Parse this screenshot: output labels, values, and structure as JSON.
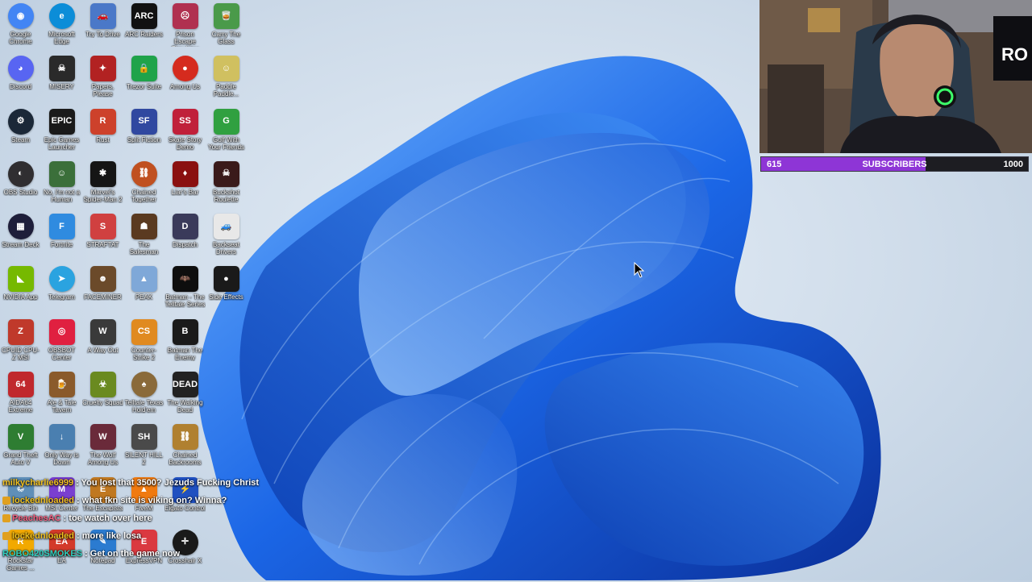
{
  "desktop_icons": [
    {
      "label": "Google Chrome",
      "icon": "chrome-icon",
      "color": "#4285f4",
      "glyph": "◉",
      "round": true
    },
    {
      "label": "Discord",
      "icon": "discord-icon",
      "color": "#5865f2",
      "glyph": "◕",
      "round": true
    },
    {
      "label": "Steam",
      "icon": "steam-icon",
      "color": "#1b2838",
      "glyph": "⚙",
      "round": true
    },
    {
      "label": "OBS Studio",
      "icon": "obs-icon",
      "color": "#302e31",
      "glyph": "◐",
      "round": true
    },
    {
      "label": "Stream Deck",
      "icon": "stream-deck-icon",
      "color": "#1e1e3a",
      "glyph": "▦",
      "round": true
    },
    {
      "label": "NVIDIA App",
      "icon": "nvidia-icon",
      "color": "#76b900",
      "glyph": "◣",
      "round": false
    },
    {
      "label": "CPUID CPU-Z MSI",
      "icon": "cpuz-icon",
      "color": "#c0392b",
      "glyph": "Z",
      "round": false
    },
    {
      "label": "AIDA64 Extreme",
      "icon": "aida64-icon",
      "color": "#c0282d",
      "glyph": "64",
      "round": false
    },
    {
      "label": "Grand Theft Auto V",
      "icon": "gta5-icon",
      "color": "#2e7d32",
      "glyph": "V",
      "round": false
    },
    {
      "label": "Recycle Bin",
      "icon": "recycle-bin-icon",
      "color": "#5f8fb8",
      "glyph": "♲",
      "round": false
    },
    {
      "label": "Rockstar Games ...",
      "icon": "rockstar-icon",
      "color": "#f2a900",
      "glyph": "R",
      "round": false
    },
    {
      "label": "Microsoft Edge",
      "icon": "edge-icon",
      "color": "#0c8dd8",
      "glyph": "e",
      "round": true
    },
    {
      "label": "MISERY",
      "icon": "misery-icon",
      "color": "#2a2a2a",
      "glyph": "☠",
      "round": false
    },
    {
      "label": "Epic Games Launcher",
      "icon": "epic-games-icon",
      "color": "#1a1a1a",
      "glyph": "EPIC",
      "round": false
    },
    {
      "label": "No, I'm not a Human",
      "icon": "no-im-not-human-icon",
      "color": "#3b6f3a",
      "glyph": "☺",
      "round": false
    },
    {
      "label": "Fortnite",
      "icon": "fortnite-icon",
      "color": "#2f8be0",
      "glyph": "F",
      "round": false
    },
    {
      "label": "Telegram",
      "icon": "telegram-icon",
      "color": "#2aa3e0",
      "glyph": "➤",
      "round": true
    },
    {
      "label": "OBSBOT Center",
      "icon": "obsbot-icon",
      "color": "#e02040",
      "glyph": "◎",
      "round": false
    },
    {
      "label": "Ale & Tale Tavern",
      "icon": "ale-tale-icon",
      "color": "#8a5a2b",
      "glyph": "🍺",
      "round": false
    },
    {
      "label": "Only Way is Down",
      "icon": "only-way-down-icon",
      "color": "#4a7fb0",
      "glyph": "↓",
      "round": false
    },
    {
      "label": "MSI Center",
      "icon": "msi-center-icon",
      "color": "#7a3fd0",
      "glyph": "M",
      "round": false
    },
    {
      "label": "EA",
      "icon": "ea-icon",
      "color": "#d33a2a",
      "glyph": "EA",
      "round": false
    },
    {
      "label": "Try To Drive",
      "icon": "try-to-drive-icon",
      "color": "#4a78c8",
      "glyph": "🚗",
      "round": false
    },
    {
      "label": "Papers, Please",
      "icon": "papers-please-icon",
      "color": "#b22222",
      "glyph": "✦",
      "round": false
    },
    {
      "label": "Rust",
      "icon": "rust-icon",
      "color": "#cd412b",
      "glyph": "R",
      "round": false
    },
    {
      "label": "Marvel's Spider-Man 2",
      "icon": "spiderman-icon",
      "color": "#151515",
      "glyph": "✱",
      "round": false
    },
    {
      "label": "STRAFTAT",
      "icon": "straftat-icon",
      "color": "#d04040",
      "glyph": "S",
      "round": false
    },
    {
      "label": "FACEMINER",
      "icon": "faceminer-icon",
      "color": "#6b4a2a",
      "glyph": "☻",
      "round": false
    },
    {
      "label": "A Way Out",
      "icon": "a-way-out-icon",
      "color": "#3a3a3a",
      "glyph": "W",
      "round": false
    },
    {
      "label": "Cruelty Squad",
      "icon": "cruelty-squad-icon",
      "color": "#6a8a20",
      "glyph": "☣",
      "round": false
    },
    {
      "label": "The Wolf Among Us",
      "icon": "wolf-among-us-icon",
      "color": "#6a2a3a",
      "glyph": "W",
      "round": false
    },
    {
      "label": "The Escapists",
      "icon": "escapists-icon",
      "color": "#c07820",
      "glyph": "E",
      "round": false
    },
    {
      "label": "Notepad",
      "icon": "notepad-icon",
      "color": "#2b7bd0",
      "glyph": "✎",
      "round": false
    },
    {
      "label": "ARC Raiders",
      "icon": "arc-raiders-icon",
      "color": "#111111",
      "glyph": "ARC",
      "round": false
    },
    {
      "label": "Trezor Suite",
      "icon": "trezor-icon",
      "color": "#1fa34a",
      "glyph": "🔒",
      "round": false
    },
    {
      "label": "Split Fiction",
      "icon": "split-fiction-icon",
      "color": "#3048a0",
      "glyph": "SF",
      "round": false
    },
    {
      "label": "Chained Together",
      "icon": "chained-together-icon",
      "color": "#c05020",
      "glyph": "⛓",
      "round": true
    },
    {
      "label": "The Salesman",
      "icon": "salesman-icon",
      "color": "#5a3a20",
      "glyph": "☗",
      "round": false
    },
    {
      "label": "PEAK",
      "icon": "peak-icon",
      "color": "#7fa8d8",
      "glyph": "▲",
      "round": false
    },
    {
      "label": "Counter-Strike 2",
      "icon": "cs2-icon",
      "color": "#e08a20",
      "glyph": "CS",
      "round": false
    },
    {
      "label": "Telltale Texas Hold'em",
      "icon": "telltale-holdem-icon",
      "color": "#8a6a3a",
      "glyph": "♠",
      "round": true
    },
    {
      "label": "SILENT HILL 2",
      "icon": "silent-hill-icon",
      "color": "#4a4a4a",
      "glyph": "SH",
      "round": false
    },
    {
      "label": "FiveM",
      "icon": "fivem-icon",
      "color": "#f07a10",
      "glyph": "▲",
      "round": false
    },
    {
      "label": "ExpressVPN",
      "icon": "expressvpn-icon",
      "color": "#da3940",
      "glyph": "E",
      "round": false
    },
    {
      "label": "Prison Escape Simulator",
      "icon": "prison-escape-icon",
      "color": "#b03050",
      "glyph": "☹",
      "round": false
    },
    {
      "label": "Among Us",
      "icon": "among-us-icon",
      "color": "#d52b1e",
      "glyph": "●",
      "round": true
    },
    {
      "label": "Skate Story Demo",
      "icon": "skate-story-icon",
      "color": "#c0203a",
      "glyph": "SS",
      "round": false
    },
    {
      "label": "Liar's Bar",
      "icon": "liars-bar-icon",
      "color": "#8a1010",
      "glyph": "♦",
      "round": false
    },
    {
      "label": "Dispatch",
      "icon": "dispatch-icon",
      "color": "#3a3a5a",
      "glyph": "D",
      "round": false
    },
    {
      "label": "Batman - The Telltale Series",
      "icon": "batman-telltale-icon",
      "color": "#0e0e0e",
      "glyph": "🦇",
      "round": false
    },
    {
      "label": "Batman The Enemy",
      "icon": "batman-enemy-icon",
      "color": "#1a1a1a",
      "glyph": "B",
      "round": false
    },
    {
      "label": "The Walking Dead",
      "icon": "walking-dead-icon",
      "color": "#222222",
      "glyph": "DEAD",
      "round": false
    },
    {
      "label": "Chained Backrooms",
      "icon": "chained-backrooms-icon",
      "color": "#b08030",
      "glyph": "⛓",
      "round": false
    },
    {
      "label": "Elgato Control",
      "icon": "elgato-icon",
      "color": "#2050c0",
      "glyph": "⚡",
      "round": false
    },
    {
      "label": "Crosshair X",
      "icon": "crosshair-x-icon",
      "color": "#1a1a1a",
      "glyph": "✛",
      "round": true
    },
    {
      "label": "Carry The Glass",
      "icon": "carry-glass-icon",
      "color": "#4a9a4a",
      "glyph": "🥃",
      "round": false
    },
    {
      "label": "Paddle Paddle...",
      "icon": "paddle-icon",
      "color": "#d0c060",
      "glyph": "☺",
      "round": false
    },
    {
      "label": "Golf With Your Friends",
      "icon": "golf-friends-icon",
      "color": "#30a040",
      "glyph": "G",
      "round": false
    },
    {
      "label": "Buckshot Roulette",
      "icon": "buckshot-icon",
      "color": "#3a1a1a",
      "glyph": "☠",
      "round": false
    },
    {
      "label": "Backseat Drivers",
      "icon": "backseat-drivers-icon",
      "color": "#e8e8e8",
      "glyph": "🚙",
      "round": false
    },
    {
      "label": "Side Effects",
      "icon": "side-effects-icon",
      "color": "#1a1a1a",
      "glyph": "●",
      "round": false
    }
  ],
  "webcam": {
    "label": "webcam-feed"
  },
  "subscriber_goal": {
    "current": "615",
    "title": "SUBSCRIBERS",
    "goal": "1000",
    "progress": 0.615
  },
  "chat": [
    {
      "user": "milkycharlie6999",
      "user_color": "#f0c020",
      "badge": false,
      "message": "You lost that 3500? Jezuds Fucking Christ"
    },
    {
      "user": "lockednloaded",
      "user_color": "#f0c020",
      "badge": true,
      "message": "what fkn site is viking on? Winna?"
    },
    {
      "user": "PeachesAC",
      "user_color": "#f06080",
      "badge": true,
      "message": "toe watch over here"
    },
    {
      "user": "lockednloaded",
      "user_color": "#f0c020",
      "badge": true,
      "message": "more like losa"
    },
    {
      "user": "ROBO420SMOKES",
      "user_color": "#30d0c0",
      "badge": false,
      "message": "Get on the game now"
    }
  ],
  "colors": {
    "wallpaper_bloom": "#1b66e6",
    "wallpaper_bg": "#d3e0ee",
    "sub_fill": "#8e35d6"
  }
}
